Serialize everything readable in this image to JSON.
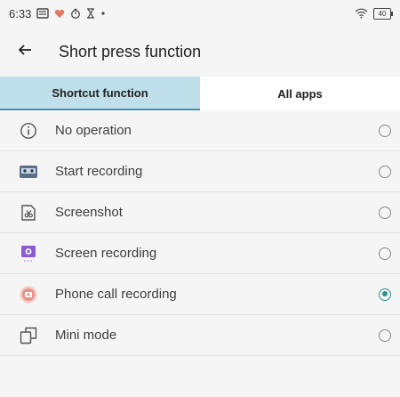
{
  "status_bar": {
    "time": "6:33",
    "battery_level": "40",
    "icons": [
      "notification-icon",
      "heart-icon",
      "timer-icon",
      "hourglass-icon",
      "dot-icon",
      "wifi-icon",
      "battery-icon"
    ]
  },
  "app_bar": {
    "title": "Short press function",
    "back_icon": "arrow-left-icon"
  },
  "tabs": [
    {
      "label": "Shortcut function",
      "active": true
    },
    {
      "label": "All apps",
      "active": false
    }
  ],
  "options": [
    {
      "label": "No operation",
      "icon": "info-icon",
      "selected": false
    },
    {
      "label": "Start recording",
      "icon": "recorder-icon",
      "selected": false
    },
    {
      "label": "Screenshot",
      "icon": "screenshot-icon",
      "selected": false
    },
    {
      "label": "Screen recording",
      "icon": "screen-recording-icon",
      "selected": false
    },
    {
      "label": "Phone call recording",
      "icon": "call-recording-icon",
      "selected": true
    },
    {
      "label": "Mini mode",
      "icon": "mini-mode-icon",
      "selected": false
    }
  ],
  "colors": {
    "accent": "#2f8f8a",
    "tab_active_bg": "#bfe0ea",
    "tab_active_underline": "#4a8fb2"
  }
}
